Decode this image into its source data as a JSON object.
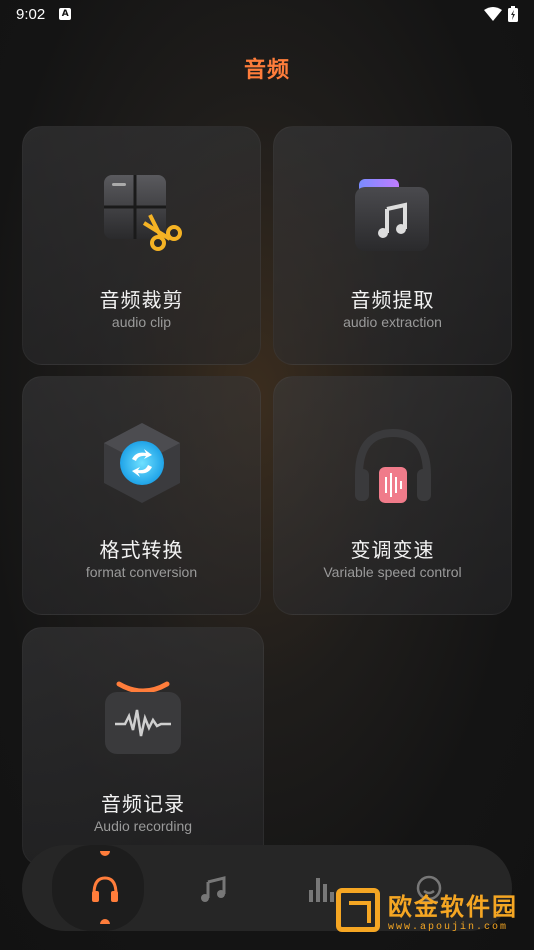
{
  "status_bar": {
    "time": "9:02",
    "notification_badge": "A"
  },
  "header": {
    "title": "音频"
  },
  "cards": [
    {
      "title": "音频裁剪",
      "subtitle": "audio clip",
      "icon": "audio-clip-icon"
    },
    {
      "title": "音频提取",
      "subtitle": "audio extraction",
      "icon": "music-folder-icon"
    },
    {
      "title": "格式转换",
      "subtitle": "format conversion",
      "icon": "convert-cube-icon"
    },
    {
      "title": "变调变速",
      "subtitle": "Variable speed control",
      "icon": "headphones-icon"
    },
    {
      "title": "音频记录",
      "subtitle": "Audio recording",
      "icon": "waveform-recorder-icon"
    }
  ],
  "bottom_nav": {
    "items": [
      {
        "name": "headphones-tab",
        "icon": "headphones-icon",
        "active": true
      },
      {
        "name": "music-tab",
        "icon": "music-note-icon",
        "active": false
      },
      {
        "name": "chart-tab",
        "icon": "bar-chart-icon",
        "active": false
      },
      {
        "name": "profile-tab",
        "icon": "smiley-profile-icon",
        "active": false
      }
    ]
  },
  "watermark": {
    "name": "欧金软件园",
    "url": "www.apoujin.com"
  },
  "colors": {
    "accent": "#ff7d3b",
    "background": "#141414",
    "card": "#2e2e30",
    "text_secondary": "#9a9a9a"
  }
}
